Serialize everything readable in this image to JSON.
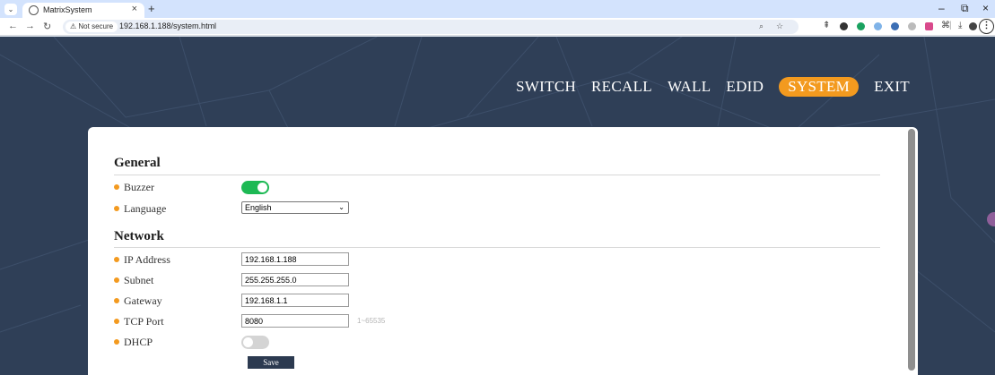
{
  "browser": {
    "tab_title": "MatrixSystem",
    "tab_close": "×",
    "new_tab": "+",
    "security_label": "Not secure",
    "url": "192.168.1.188/system.html",
    "window_controls": [
      "–",
      "⧉",
      "×"
    ],
    "icons": [
      "tab-search-icon",
      "favicon-icon",
      "back-icon",
      "forward-icon",
      "reload-icon",
      "warning-icon",
      "zoom-icon",
      "bookmark-star-icon",
      "extension-icons",
      "download-icon",
      "profile-icon",
      "menu-icon"
    ]
  },
  "nav": {
    "items": [
      {
        "label": "SWITCH",
        "active": false
      },
      {
        "label": "RECALL",
        "active": false
      },
      {
        "label": "WALL",
        "active": false
      },
      {
        "label": "EDID",
        "active": false
      },
      {
        "label": "SYSTEM",
        "active": true
      },
      {
        "label": "EXIT",
        "active": false
      }
    ]
  },
  "general": {
    "title": "General",
    "buzzer_label": "Buzzer",
    "buzzer_on": true,
    "language_label": "Language",
    "language_value": "English"
  },
  "network": {
    "title": "Network",
    "ip_label": "IP Address",
    "ip_value": "192.168.1.188",
    "subnet_label": "Subnet",
    "subnet_value": "255.255.255.0",
    "gateway_label": "Gateway",
    "gateway_value": "192.168.1.1",
    "tcp_label": "TCP Port",
    "tcp_value": "8080",
    "tcp_hint": "1~65535",
    "dhcp_label": "DHCP",
    "dhcp_on": false
  },
  "save_label": "Save",
  "colors": {
    "accent": "#f39a1f",
    "toggle_on": "#1db954",
    "page_bg": "#2f3f57",
    "save_button": "#2c3a50"
  }
}
